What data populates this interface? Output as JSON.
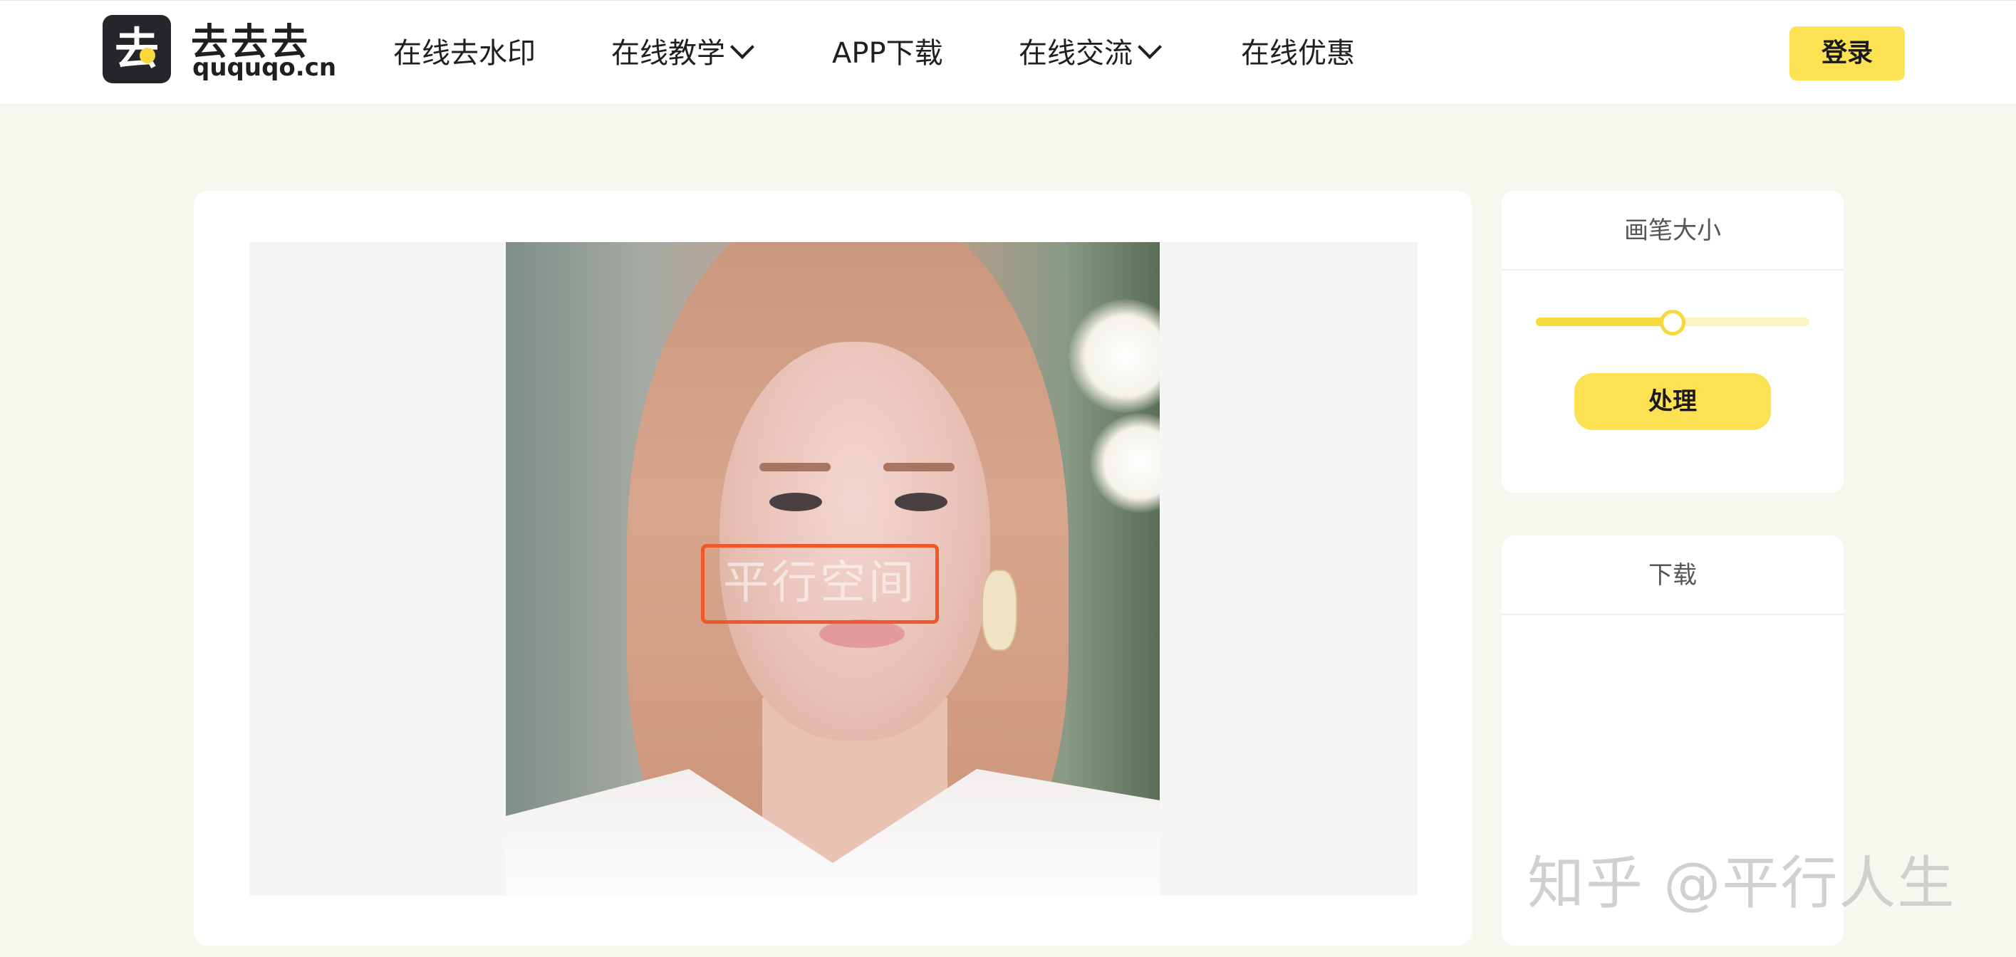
{
  "header": {
    "logo_cn": "去去去",
    "logo_en": "ququqo.cn",
    "nav": [
      {
        "label": "在线去水印",
        "dropdown": false
      },
      {
        "label": "在线教学",
        "dropdown": true
      },
      {
        "label": "APP下载",
        "dropdown": false
      },
      {
        "label": "在线交流",
        "dropdown": true
      },
      {
        "label": "在线优惠",
        "dropdown": false
      }
    ],
    "login_label": "登录"
  },
  "editor": {
    "watermark_text": "平行空间"
  },
  "brush_panel": {
    "title": "画笔大小",
    "slider_value": 0.5,
    "process_label": "处理"
  },
  "download_panel": {
    "title": "下载"
  },
  "overlay_watermark": "知乎 @平行人生",
  "colors": {
    "accent": "#fce253",
    "accent_strong": "#f7d93b",
    "watermark_box": "#f0582a",
    "page_bg": "#f8f7ef"
  }
}
